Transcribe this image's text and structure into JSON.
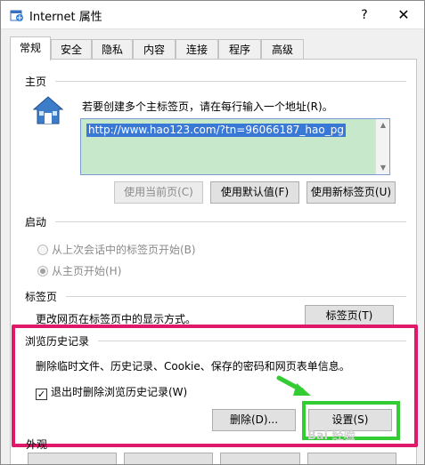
{
  "window": {
    "title": "Internet 属性",
    "help": "?",
    "close": "✕"
  },
  "tabs": [
    "常规",
    "安全",
    "隐私",
    "内容",
    "连接",
    "程序",
    "高级"
  ],
  "home": {
    "section_title": "主页",
    "description": "若要创建多个主标签页，请在每行输入一个地址(R)。",
    "url": "http://www.hao123.com/?tn=96066187_hao_pg",
    "use_current": "使用当前页(C)",
    "use_default": "使用默认值(F)",
    "use_new_tab": "使用新标签页(U)"
  },
  "startup": {
    "section_title": "启动",
    "option_last_session": "从上次会话中的标签页开始(B)",
    "option_home": "从主页开始(H)"
  },
  "tabs_section": {
    "section_title": "标签页",
    "description": "更改网页在标签页中的显示方式。",
    "button": "标签页(T)"
  },
  "history": {
    "section_title": "浏览历史记录",
    "description": "删除临时文件、历史记录、Cookie、保存的密码和网页表单信息。",
    "checkbox_label": "退出时删除浏览历史记录(W)",
    "checkbox_checked": true,
    "delete_button": "删除(D)...",
    "settings_button": "设置(S)"
  },
  "colors": {
    "highlight_red": "#e0186a",
    "highlight_green": "#33cc33",
    "url_bg": "#c8e8cc",
    "selection": "#3a78d6"
  },
  "footer": {
    "section_title": "外观"
  },
  "watermark": "Bai 经验"
}
